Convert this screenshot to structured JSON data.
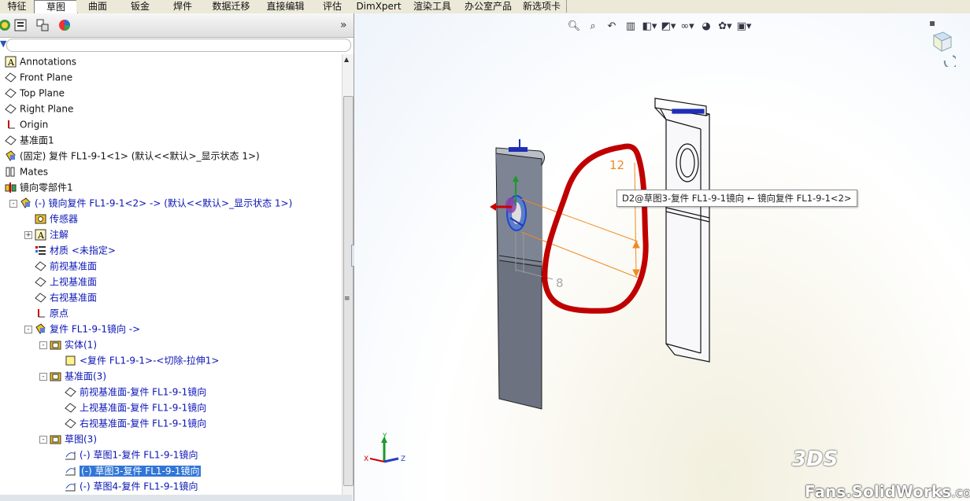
{
  "tabs": [
    "特征",
    "草图",
    "曲面",
    "钣金",
    "焊件",
    "数据迁移",
    "直接编辑",
    "评估",
    "DimXpert",
    "渲染工具",
    "办公室产品",
    "新选项卡"
  ],
  "active_tab": "草图",
  "panel": {
    "more": "»"
  },
  "tree": [
    {
      "label": "Annotations",
      "icon": "annotation-icon"
    },
    {
      "label": "Front Plane",
      "icon": "plane-icon"
    },
    {
      "label": "Top Plane",
      "icon": "plane-icon"
    },
    {
      "label": "Right Plane",
      "icon": "plane-icon"
    },
    {
      "label": "Origin",
      "icon": "origin-icon"
    },
    {
      "label": "基准面1",
      "icon": "plane-icon"
    },
    {
      "label": "(固定) 复件 FL1-9-1<1> (默认<<默认>_显示状态 1>)",
      "icon": "part-icon"
    },
    {
      "label": "Mates",
      "icon": "mates-icon"
    },
    {
      "label": "镜向零部件1",
      "icon": "mirror-icon"
    },
    {
      "label": "(-) 镜向复件 FL1-9-1<2> -> (默认<<默认>_显示状态 1>)",
      "icon": "part-icon"
    },
    {
      "label": "传感器",
      "icon": "sensor-icon"
    },
    {
      "label": "注解",
      "icon": "annotation-icon"
    },
    {
      "label": "材质 <未指定>",
      "icon": "material-icon"
    },
    {
      "label": "前视基准面",
      "icon": "plane-icon"
    },
    {
      "label": "上视基准面",
      "icon": "plane-icon"
    },
    {
      "label": "右视基准面",
      "icon": "plane-icon"
    },
    {
      "label": "原点",
      "icon": "origin-icon"
    },
    {
      "label": "复件 FL1-9-1镜向 ->",
      "icon": "part-icon"
    },
    {
      "label": "实体(1)",
      "icon": "folder-icon"
    },
    {
      "label": "<复件 FL1-9-1>-<切除-拉伸1>",
      "icon": "body-icon"
    },
    {
      "label": "基准面(3)",
      "icon": "folder-icon"
    },
    {
      "label": "前视基准面-复件 FL1-9-1镜向",
      "icon": "plane-icon"
    },
    {
      "label": "上视基准面-复件 FL1-9-1镜向",
      "icon": "plane-icon"
    },
    {
      "label": "右视基准面-复件 FL1-9-1镜向",
      "icon": "plane-icon"
    },
    {
      "label": "草图(3)",
      "icon": "folder-icon"
    },
    {
      "label": "(-) 草图1-复件 FL1-9-1镜向",
      "icon": "sketch-icon"
    },
    {
      "label": "(-) 草图3-复件 FL1-9-1镜向",
      "icon": "sketch-icon"
    },
    {
      "label": "(-) 草图4-复件 FL1-9-1镜向",
      "icon": "sketch-icon"
    }
  ],
  "selected_item": "(-) 草图3-复件 FL1-9-1镜向",
  "viewport": {
    "tooltip": "D2@草图3-复件 FL1-9-1镜向 ← 镜向复件 FL1-9-1<2>",
    "dimension_a": "12",
    "dimension_b": "8",
    "triad": {
      "x": "X",
      "y": "Y",
      "z": "Z"
    },
    "watermark_main": "Fans.SolidWorks",
    "watermark_domain": ".com.cn",
    "logo": "3DS"
  },
  "colors": {
    "accent": "#3176d6",
    "annotation_red": "#c00000",
    "dimension": "#f08a24"
  }
}
